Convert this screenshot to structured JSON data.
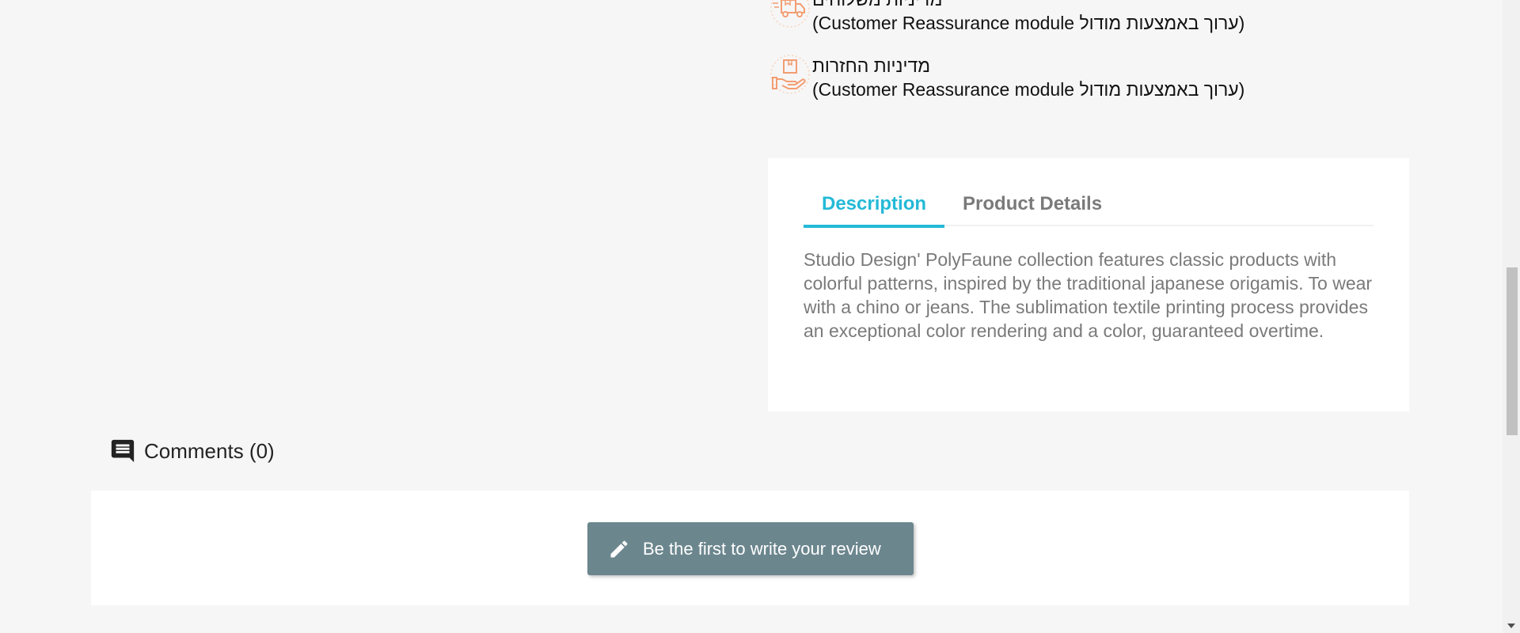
{
  "reassurance": {
    "items": [
      {
        "icon": "delivery-truck-icon",
        "title": "מדיניות משלוחים",
        "description": "(ערוך באמצעות מודול Customer Reassurance module)"
      },
      {
        "icon": "return-package-icon",
        "title": "מדיניות החזרות",
        "description": "(ערוך באמצעות מודול Customer Reassurance module)"
      }
    ]
  },
  "tabs": {
    "items": [
      {
        "label": "Description",
        "active": true
      },
      {
        "label": "Product Details",
        "active": false
      }
    ],
    "description_text": "Studio Design' PolyFaune collection features classic products with colorful patterns, inspired by the traditional japanese origamis. To wear with a chino or jeans. The sublimation textile printing process provides an exceptional color rendering and a color, guaranteed overtime."
  },
  "comments": {
    "icon": "comment-icon",
    "title": "Comments (0)",
    "review_button_label": "Be the first to write your review",
    "review_button_icon": "pencil-icon"
  },
  "colors": {
    "accent": "#24b9d7",
    "button": "#6c868e",
    "icon_orange": "#f39d72",
    "background": "#f6f6f6"
  }
}
